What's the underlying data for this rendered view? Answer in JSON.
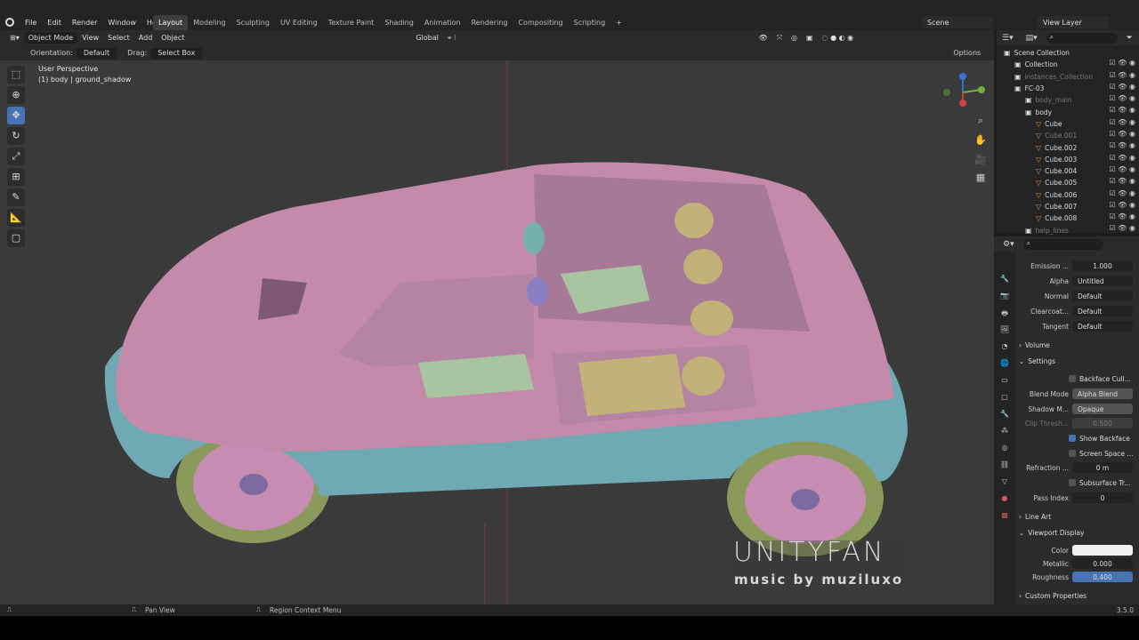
{
  "menu": [
    "File",
    "Edit",
    "Render",
    "Window",
    "Help"
  ],
  "workspaces": [
    "Layout",
    "Modeling",
    "Sculpting",
    "UV Editing",
    "Texture Paint",
    "Shading",
    "Animation",
    "Rendering",
    "Compositing",
    "Scripting",
    "+"
  ],
  "scene": "Scene",
  "view_layer": "View Layer",
  "header": {
    "mode": "Object Mode",
    "view": "View",
    "select": "Select",
    "add": "Add",
    "object": "Object",
    "transform": "Global"
  },
  "tool_settings": {
    "orientation_label": "Orientation:",
    "orientation": "Default",
    "drag_label": "Drag:",
    "drag": "Select Box",
    "options": "Options"
  },
  "viewport": {
    "perspective": "User Perspective",
    "context": "(1) body | ground_shadow"
  },
  "gizmo": {
    "x": "X",
    "y": "Y",
    "z": "Z"
  },
  "outliner": {
    "items": [
      {
        "name": "Scene Collection",
        "depth": 0,
        "dim": false
      },
      {
        "name": "Collection",
        "depth": 1,
        "dim": false
      },
      {
        "name": "instances_Collection",
        "depth": 1,
        "dim": true
      },
      {
        "name": "FC-03",
        "depth": 1,
        "dim": false
      },
      {
        "name": "body_main",
        "depth": 2,
        "dim": true
      },
      {
        "name": "body",
        "depth": 2,
        "dim": false
      },
      {
        "name": "Cube",
        "depth": 3,
        "dim": false
      },
      {
        "name": "Cube.001",
        "depth": 3,
        "dim": true
      },
      {
        "name": "Cube.002",
        "depth": 3,
        "dim": false
      },
      {
        "name": "Cube.003",
        "depth": 3,
        "dim": false
      },
      {
        "name": "Cube.004",
        "depth": 3,
        "dim": false
      },
      {
        "name": "Cube.005",
        "depth": 3,
        "dim": false
      },
      {
        "name": "Cube.006",
        "depth": 3,
        "dim": false
      },
      {
        "name": "Cube.007",
        "depth": 3,
        "dim": false
      },
      {
        "name": "Cube.008",
        "depth": 3,
        "dim": false
      },
      {
        "name": "help_lines",
        "depth": 2,
        "dim": true
      }
    ]
  },
  "properties": {
    "emission": {
      "label": "Emission ...",
      "value": "1.000"
    },
    "alpha": {
      "label": "Alpha",
      "value": "Untitled"
    },
    "normal": {
      "label": "Normal",
      "value": "Default"
    },
    "clearcoat": {
      "label": "Clearcoat...",
      "value": "Default"
    },
    "tangent": {
      "label": "Tangent",
      "value": "Default"
    },
    "volume": "Volume",
    "settings": "Settings",
    "backface_culling": "Backface Cull...",
    "blend_mode": {
      "label": "Blend Mode",
      "value": "Alpha Blend"
    },
    "shadow_mode": {
      "label": "Shadow M...",
      "value": "Opaque"
    },
    "clip_threshold": {
      "label": "Clip Thresh...",
      "value": "0.500"
    },
    "show_backface": "Show Backface",
    "screen_space": "Screen Space ...",
    "refraction": {
      "label": "Refraction ...",
      "value": "0 m"
    },
    "subsurface": "Subsurface Tr...",
    "pass_index": {
      "label": "Pass Index",
      "value": "0"
    },
    "line_art": "Line Art",
    "viewport_display": "Viewport Display",
    "color": {
      "label": "Color"
    },
    "metallic": {
      "label": "Metallic",
      "value": "0.000"
    },
    "roughness": {
      "label": "Roughness",
      "value": "0.400"
    },
    "custom_properties": "Custom Properties"
  },
  "status": {
    "pan": "Pan View",
    "context_menu": "Region Context Menu",
    "version": "3.5.0"
  },
  "watermark": {
    "title": "UNITYFAN",
    "subtitle": "music by muziluxo"
  },
  "colors": {
    "accent": "#4772b3",
    "car_body": "#c48aa9",
    "car_lower": "#6fa9b4",
    "viewport_bg": "#3a3a3a"
  }
}
